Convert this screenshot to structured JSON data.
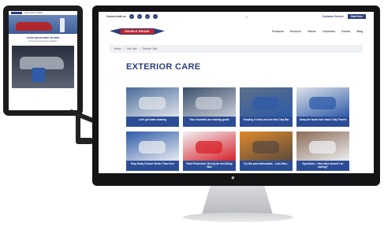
{
  "tablet": {
    "header_text": "Lorem ipsum header",
    "title": "Lorem ipsum dolor sit amet",
    "subtitle": "Sed do eiusmod tempor incididunt"
  },
  "site": {
    "top_label": "Connect with us",
    "social_icons": [
      "f",
      "t",
      "y",
      "i"
    ],
    "search_symbol": "⌕",
    "top_links": [
      "Customer Service"
    ],
    "top_button": "Start Here",
    "logo_text": "DOUBLE BRAND",
    "nav": [
      "Products",
      "Services",
      "Videos",
      "Collection",
      "Events",
      "Blog"
    ],
    "breadcrumb": [
      "Home",
      "Car Care",
      "Exterior Care"
    ],
    "page_title": "EXTERIOR CARE"
  },
  "cards": [
    {
      "caption": "Let's get foam cleaning",
      "colors": [
        "#4a6b9a",
        "#dfe3ea"
      ]
    },
    {
      "caption": "Your essential car washing guide",
      "colors": [
        "#3b4f6a",
        "#c7ccd6"
      ]
    },
    {
      "caption": "Keeping it shiny and win this Clay Bar",
      "colors": [
        "#5d6f86",
        "#2f5ba8"
      ]
    },
    {
      "caption": "Using the faster and easier Clay Towels",
      "colors": [
        "#dfe3ea",
        "#2f5ba8"
      ]
    },
    {
      "caption": "Easy Body Cleaner Better Than Ever",
      "colors": [
        "#2f5ba8",
        "#e8ebf0"
      ]
    },
    {
      "caption": "Paint Protection: Giving the best Body Wax",
      "colors": [
        "#f0f1f4",
        "#d8222a"
      ]
    },
    {
      "caption": "Try this pad enthusiasts... Less Wax...",
      "colors": [
        "#e08a2b",
        "#5a4a3d"
      ]
    },
    {
      "caption": "Speedster... How often should I be waxing?",
      "colors": [
        "#8b6b55",
        "#eceef1"
      ]
    }
  ]
}
